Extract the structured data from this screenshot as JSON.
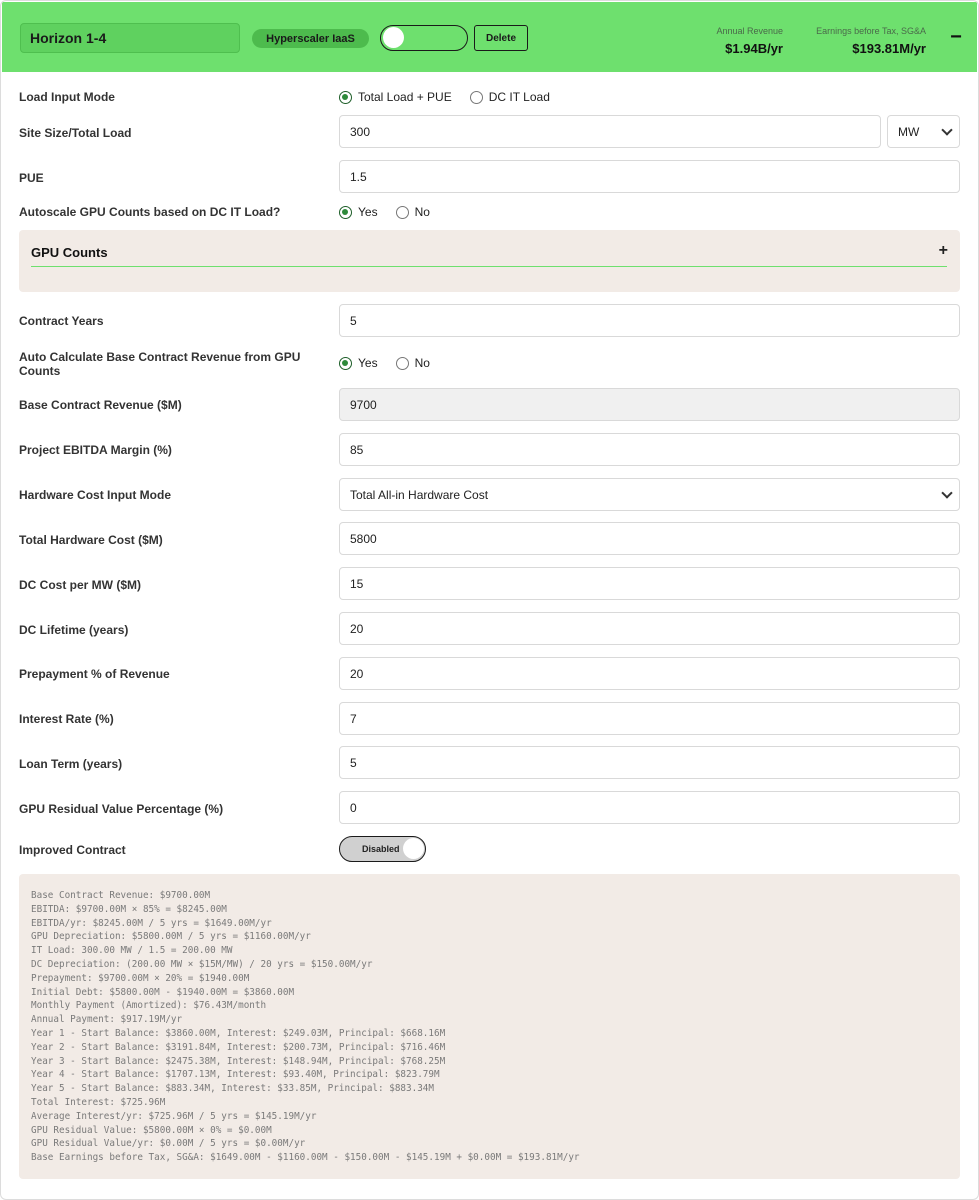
{
  "header": {
    "name": "Horizon 1-4",
    "type_badge": "Hyperscaler IaaS",
    "delete_label": "Delete",
    "annual_revenue_label": "Annual Revenue",
    "annual_revenue_value": "$1.94B/yr",
    "ebt_label": "Earnings before Tax, SG&A",
    "ebt_value": "$193.81M/yr",
    "collapse_symbol": "−",
    "accent_color": "#6ee06e"
  },
  "form": {
    "load_input_mode": {
      "label": "Load Input Mode",
      "options": [
        "Total Load + PUE",
        "DC IT Load"
      ],
      "selected": "Total Load + PUE"
    },
    "site_size": {
      "label": "Site Size/Total Load",
      "value": "300",
      "unit": "MW"
    },
    "pue": {
      "label": "PUE",
      "value": "1.5"
    },
    "autoscale": {
      "label": "Autoscale GPU Counts based on DC IT Load?",
      "options": [
        "Yes",
        "No"
      ],
      "selected": "Yes"
    },
    "gpu_counts": {
      "title": "GPU Counts",
      "expand_symbol": "+"
    },
    "contract_years": {
      "label": "Contract Years",
      "value": "5"
    },
    "auto_calc_revenue": {
      "label": "Auto Calculate Base Contract Revenue from GPU Counts",
      "options": [
        "Yes",
        "No"
      ],
      "selected": "Yes"
    },
    "base_contract_revenue": {
      "label": "Base Contract Revenue ($M)",
      "value": "9700"
    },
    "ebitda_margin": {
      "label": "Project EBITDA Margin (%)",
      "value": "85"
    },
    "hw_cost_mode": {
      "label": "Hardware Cost Input Mode",
      "value": "Total All-in Hardware Cost"
    },
    "total_hw_cost": {
      "label": "Total Hardware Cost ($M)",
      "value": "5800"
    },
    "dc_cost_per_mw": {
      "label": "DC Cost per MW ($M)",
      "value": "15"
    },
    "dc_lifetime": {
      "label": "DC Lifetime (years)",
      "value": "20"
    },
    "prepayment": {
      "label": "Prepayment % of Revenue",
      "value": "20"
    },
    "interest_rate": {
      "label": "Interest Rate (%)",
      "value": "7"
    },
    "loan_term": {
      "label": "Loan Term (years)",
      "value": "5"
    },
    "gpu_residual": {
      "label": "GPU Residual Value Percentage (%)",
      "value": "0"
    },
    "improved_contract": {
      "label": "Improved Contract",
      "toggle_text": "Disabled"
    }
  },
  "calculation_lines": [
    "Base Contract Revenue: $9700.00M",
    "EBITDA: $9700.00M × 85% = $8245.00M",
    "EBITDA/yr: $8245.00M / 5 yrs = $1649.00M/yr",
    "GPU Depreciation: $5800.00M / 5 yrs = $1160.00M/yr",
    "IT Load: 300.00 MW / 1.5 = 200.00 MW",
    "DC Depreciation: (200.00 MW × $15M/MW) / 20 yrs = $150.00M/yr",
    "Prepayment: $9700.00M × 20% = $1940.00M",
    "Initial Debt: $5800.00M - $1940.00M = $3860.00M",
    "Monthly Payment (Amortized): $76.43M/month",
    "Annual Payment: $917.19M/yr",
    "Year 1 - Start Balance: $3860.00M, Interest: $249.03M, Principal: $668.16M",
    "Year 2 - Start Balance: $3191.84M, Interest: $200.73M, Principal: $716.46M",
    "Year 3 - Start Balance: $2475.38M, Interest: $148.94M, Principal: $768.25M",
    "Year 4 - Start Balance: $1707.13M, Interest: $93.40M, Principal: $823.79M",
    "Year 5 - Start Balance: $883.34M, Interest: $33.85M, Principal: $883.34M",
    "Total Interest: $725.96M",
    "Average Interest/yr: $725.96M / 5 yrs = $145.19M/yr",
    "GPU Residual Value: $5800.00M × 0% = $0.00M",
    "GPU Residual Value/yr: $0.00M / 5 yrs = $0.00M/yr",
    "Base Earnings before Tax, SG&A: $1649.00M - $1160.00M - $150.00M - $145.19M + $0.00M = $193.81M/yr"
  ]
}
